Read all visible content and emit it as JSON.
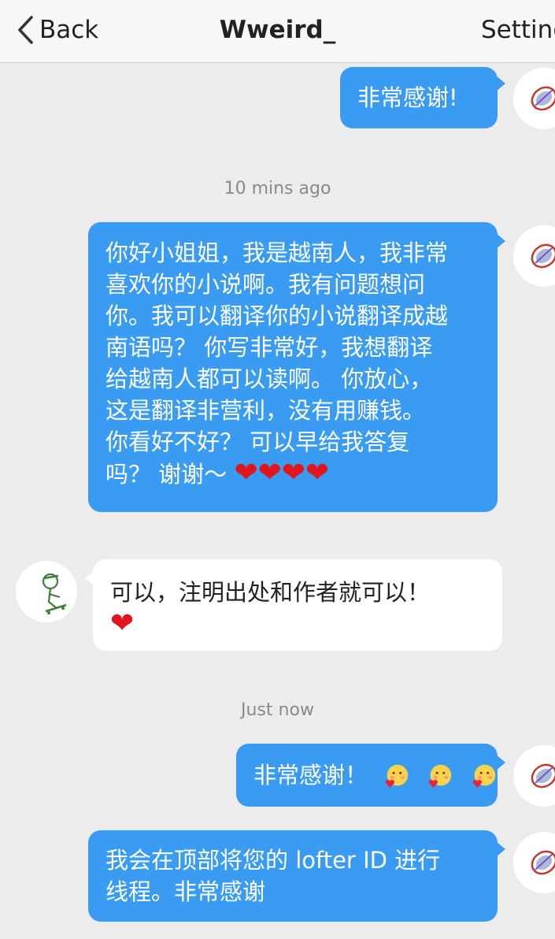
{
  "header": {
    "back_label": "Back",
    "title": "Wweird_",
    "settings_label": "Setting"
  },
  "timestamps": [
    "10 mins ago",
    "Just now"
  ],
  "messages": [
    {
      "sender": "self",
      "text": "非常感谢!"
    },
    {
      "sender": "self",
      "lines": [
        "你好小姐姐，我是越南人，我非常",
        "喜欢你的小说啊。我有问题想问",
        "你。我可以翻译你的小说翻译成越",
        "南语吗？ 你写非常好，我想翻译",
        "给越南人都可以读啊。 你放心，",
        "这是翻译非营利，没有用赚钱。",
        "你看好不好？ 可以早给我答复",
        "吗？ 谢谢～"
      ],
      "hearts": "❤❤❤❤"
    },
    {
      "sender": "other",
      "text": "可以，注明出处和作者就可以！",
      "hearts": "❤"
    },
    {
      "sender": "self",
      "text": "非常感谢！",
      "emoji": [
        "face-with-heart-emoji",
        "face-with-heart-emoji",
        "face-with-heart-emoji"
      ]
    },
    {
      "sender": "self",
      "lines": [
        "我会在顶部将您的 lofter ID 进行",
        "线程。非常感谢"
      ]
    }
  ],
  "colors": {
    "outgoing_bubble": "#3a9bf3",
    "incoming_bubble": "#ffffff",
    "background": "#ececec",
    "heart": "#e0161c"
  }
}
